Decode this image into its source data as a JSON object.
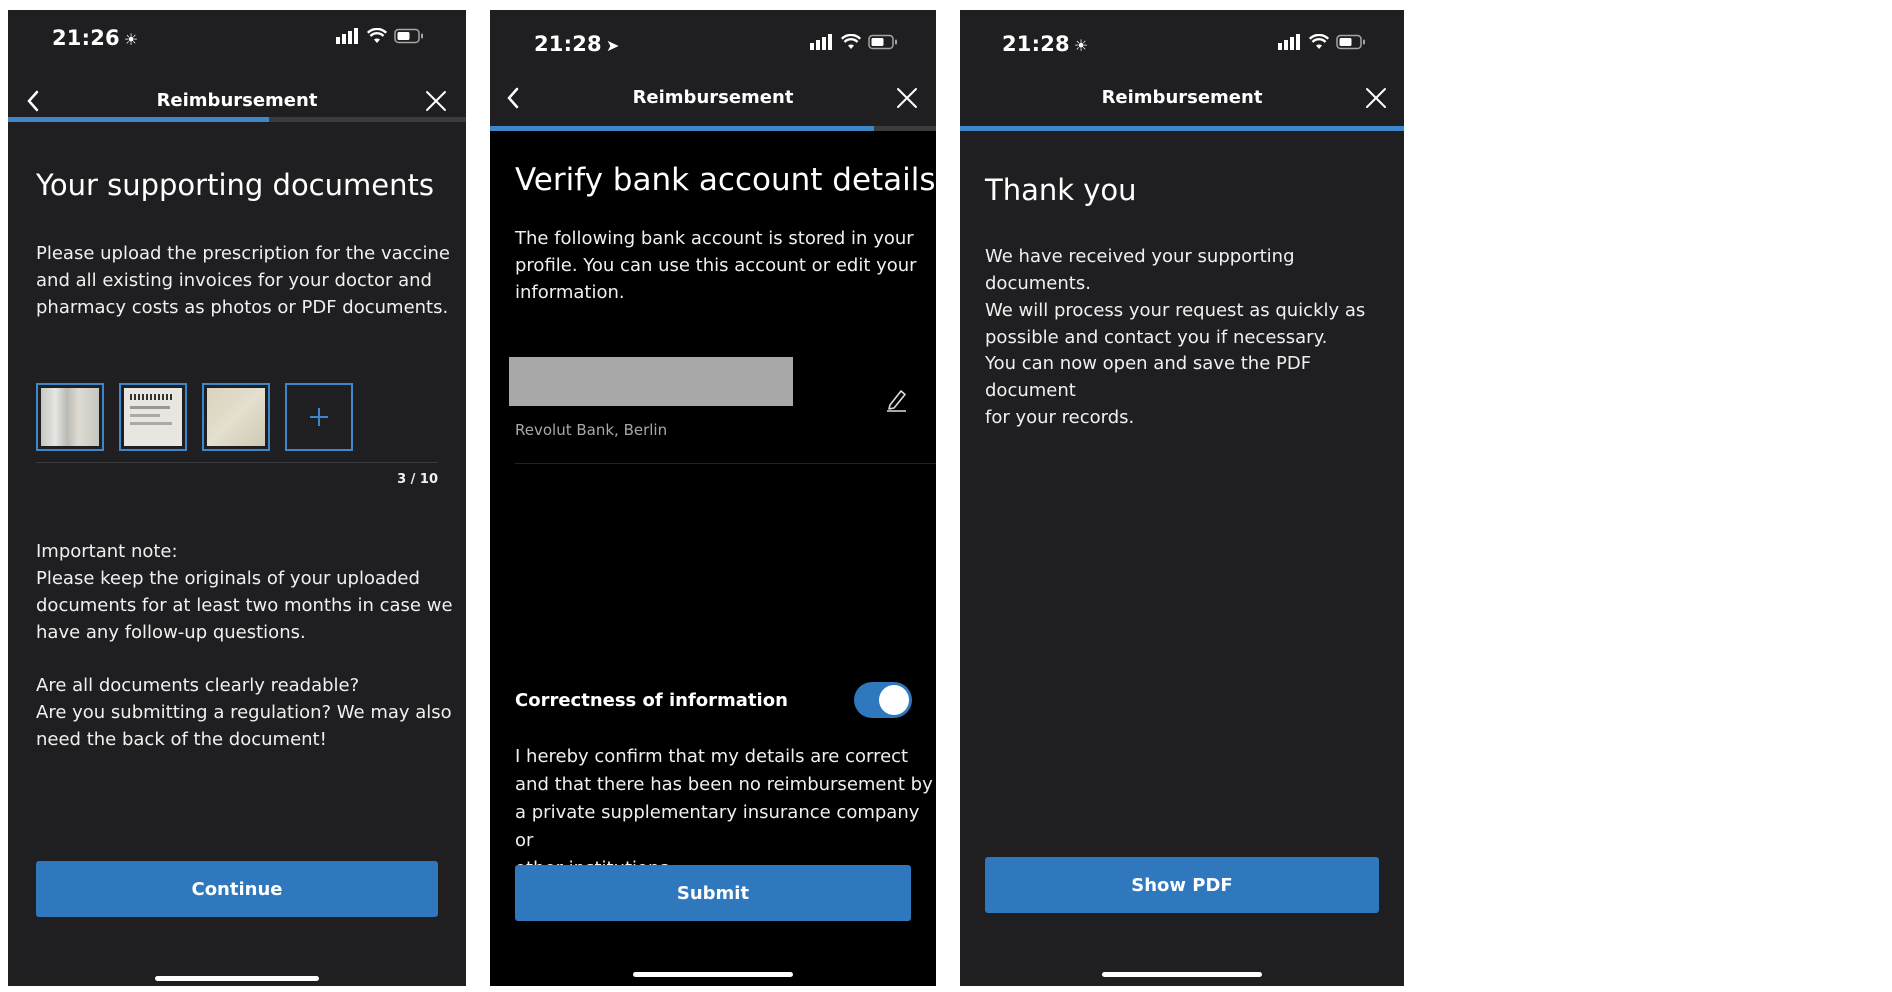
{
  "colors": {
    "accent": "#2f78bd",
    "progress": "#3f86c9",
    "screen_bg": "#1f1f21",
    "screen_bg_alt": "#000000"
  },
  "screen1": {
    "status": {
      "time": "21:26",
      "time_icon": "sleep-mode-icon"
    },
    "nav": {
      "title": "Reimbursement",
      "progress": 0.57
    },
    "heading": "Your supporting documents",
    "intro": "Please upload the prescription for the vaccine\nand all existing invoices for your doctor and\npharmacy costs as photos or PDF documents.",
    "thumbnails": [
      {
        "name": "document-thumbnail-1"
      },
      {
        "name": "document-thumbnail-2"
      },
      {
        "name": "document-thumbnail-3"
      }
    ],
    "counter": "3 / 10",
    "note": "Important note:\nPlease keep the originals of your uploaded\ndocuments for at least two months in case we\nhave any follow-up questions.",
    "questions": "Are all documents clearly readable?\nAre you submitting a regulation? We may also\nneed the back of the document!",
    "button": "Continue"
  },
  "screen2": {
    "status": {
      "time": "21:28",
      "time_icon": "location-arrow-icon"
    },
    "nav": {
      "title": "Reimbursement",
      "progress": 0.86
    },
    "heading": "Verify bank account details",
    "intro": "The following bank account is stored in your\nprofile. You can use this account or edit your\ninformation.",
    "bank_name": "Revolut Bank, Berlin",
    "toggle_label": "Correctness of information",
    "toggle_on": true,
    "confirm": "I hereby confirm that my details are correct\nand that there has been no reimbursement by\na private supplementary insurance company or\nother institutions.",
    "button": "Submit"
  },
  "screen3": {
    "status": {
      "time": "21:28",
      "time_icon": "sleep-mode-icon"
    },
    "nav": {
      "title": "Reimbursement",
      "progress": 1.0
    },
    "heading": "Thank you",
    "para1": "We have received your supporting documents.\nWe will process your request as quickly as\npossible and contact you if necessary.",
    "para2": "You can now open and save the PDF document\nfor your records.",
    "button": "Show PDF"
  }
}
